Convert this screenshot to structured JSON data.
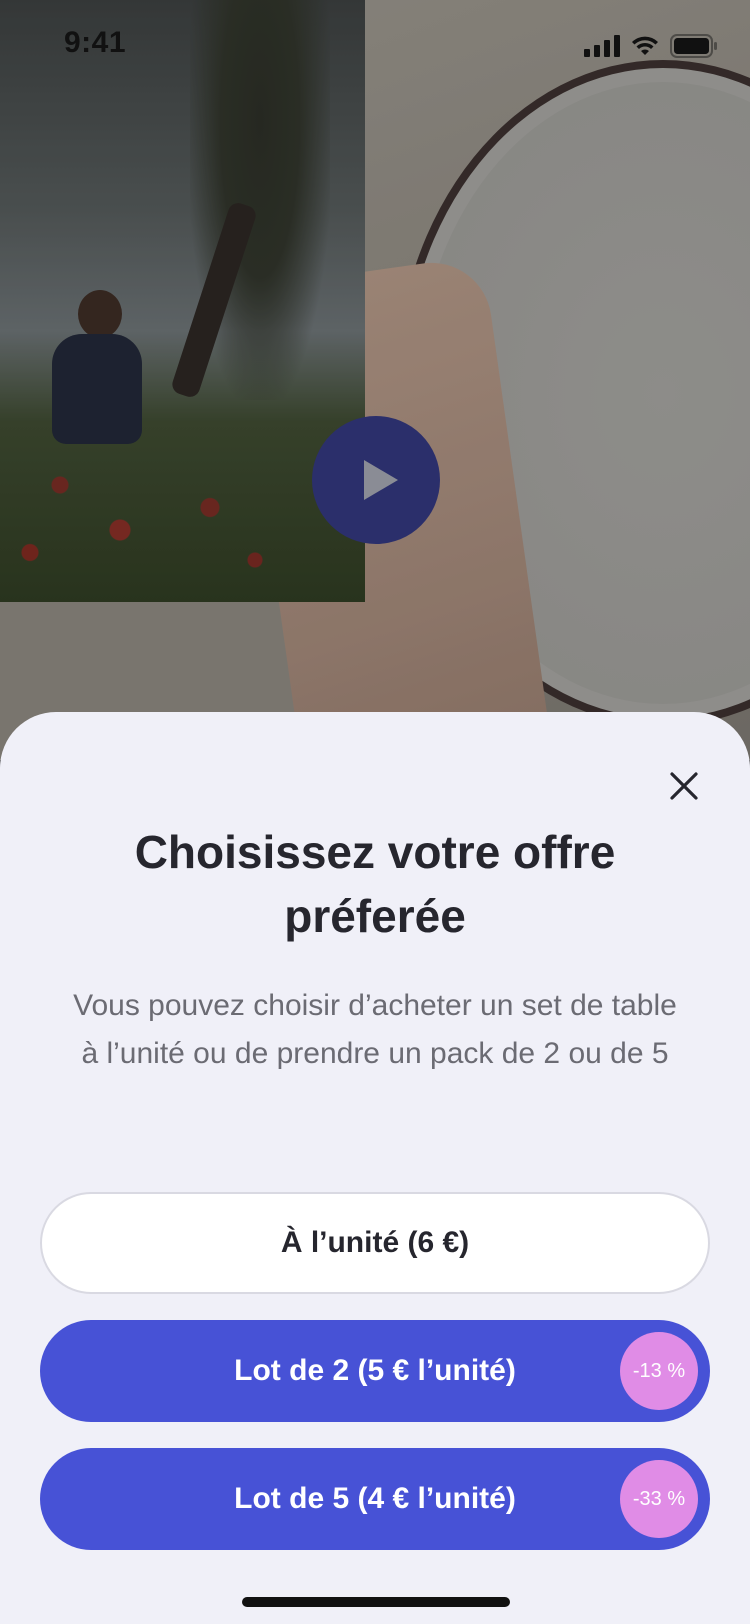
{
  "status_bar": {
    "time": "9:41"
  },
  "media": {
    "play_icon": "play-icon"
  },
  "sheet": {
    "close_icon": "close-icon",
    "title": "Choisissez votre offre préferée",
    "description": "Vous pouvez choisir d’acheter un set de table à l’unité ou de prendre un pack de 2 ou de 5",
    "options": [
      {
        "label": "À l’unité (6 €)",
        "badge": ""
      },
      {
        "label": "Lot de 2 (5 € l’unité)",
        "badge": "-13 %"
      },
      {
        "label": "Lot de 5 (4 € l’unité)",
        "badge": "-33 %"
      }
    ]
  },
  "colors": {
    "sheet_background": "#f0f0f8",
    "primary_button": "#4752d6",
    "discount_badge": "#e08ce6",
    "play_button": "#2b2f6b",
    "title_text": "#26262e",
    "body_text": "#6b6b73"
  }
}
